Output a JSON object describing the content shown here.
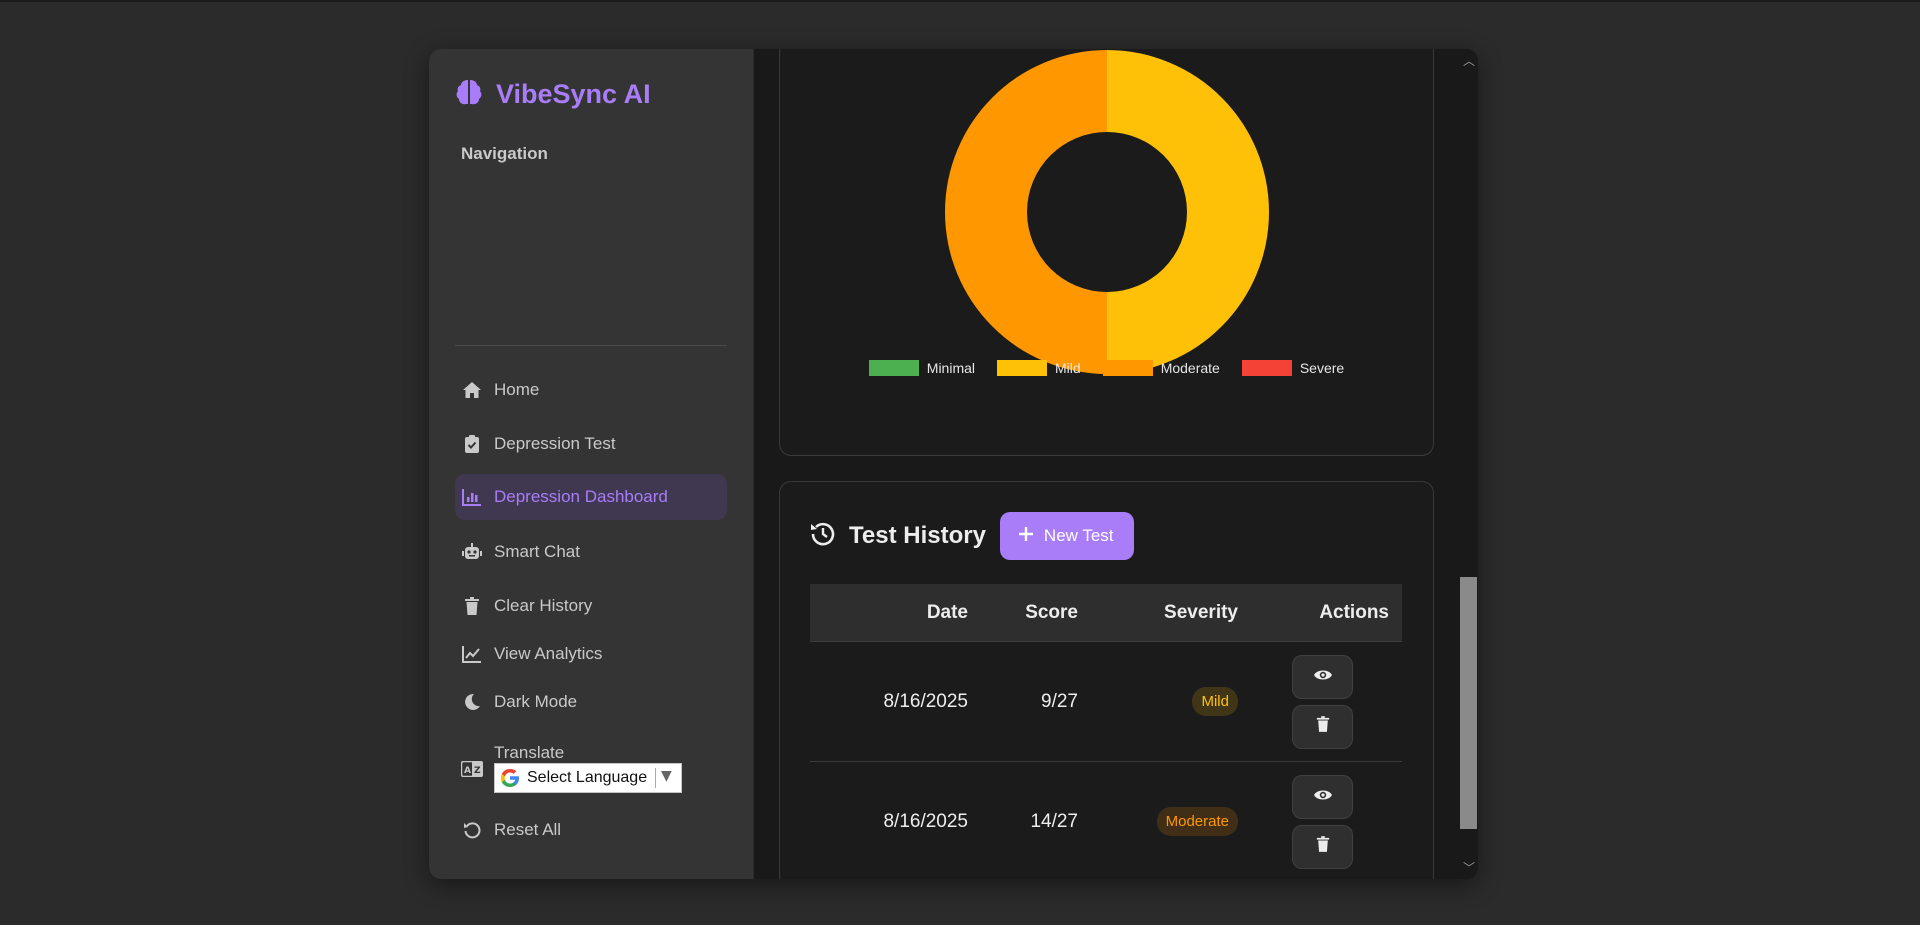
{
  "app": {
    "brand": "VibeSync AI"
  },
  "sidebar": {
    "heading": "Navigation",
    "items": [
      {
        "label": "Home",
        "icon": "home-icon"
      },
      {
        "label": "Depression Test",
        "icon": "clipboard-check-icon"
      },
      {
        "label": "Depression Dashboard",
        "icon": "bar-chart-icon",
        "active": true
      },
      {
        "label": "Smart Chat",
        "icon": "robot-icon"
      },
      {
        "label": "Clear History",
        "icon": "trash-icon"
      },
      {
        "label": "View Analytics",
        "icon": "line-chart-icon"
      },
      {
        "label": "Dark Mode",
        "icon": "moon-icon"
      },
      {
        "label": "Translate",
        "icon": "language-icon"
      },
      {
        "label": "Reset All",
        "icon": "reset-icon"
      }
    ],
    "language_select": "Select Language"
  },
  "chart_data": {
    "type": "pie",
    "variant": "doughnut",
    "categories": [
      "Minimal",
      "Mild",
      "Moderate",
      "Severe"
    ],
    "values": [
      0,
      1,
      1,
      0
    ],
    "colors": [
      "#4caf50",
      "#ffc107",
      "#ff9800",
      "#f44336"
    ],
    "legend_position": "bottom"
  },
  "history": {
    "title": "Test History",
    "new_test_label": "New Test",
    "columns": [
      "Date",
      "Score",
      "Severity",
      "Actions"
    ],
    "rows": [
      {
        "date": "8/16/2025",
        "score": "9/27",
        "severity": "Mild",
        "severity_color": "#ffc107"
      },
      {
        "date": "8/16/2025",
        "score": "14/27",
        "severity": "Moderate",
        "severity_color": "#ff9800"
      }
    ]
  },
  "colors": {
    "accent": "#a97cf8",
    "background": "#191919",
    "sidebar": "#343434"
  }
}
